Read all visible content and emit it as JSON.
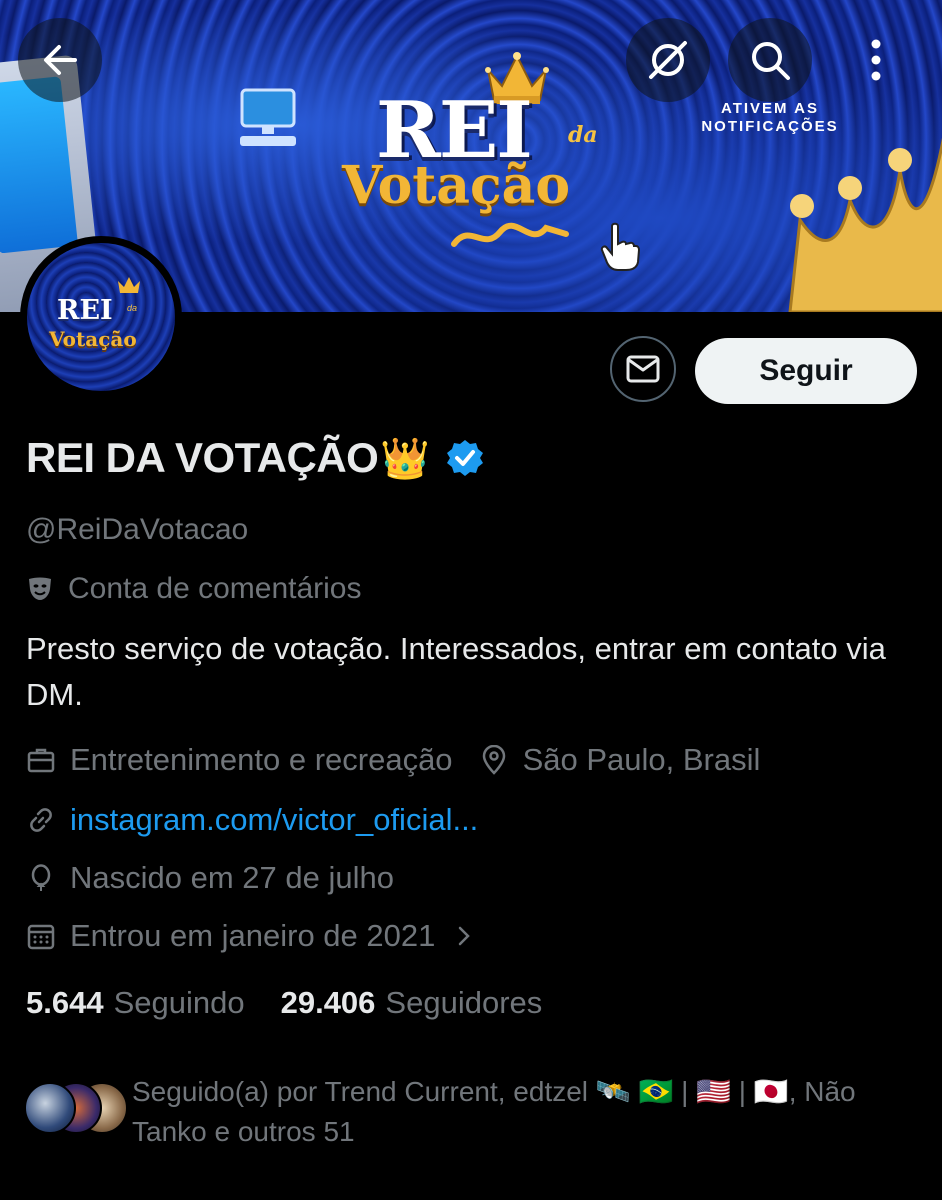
{
  "banner": {
    "title_rei": "REI",
    "title_da": "da",
    "title_votacao": "Votação",
    "notification_line1": "ATIVEM AS",
    "notification_line2": "NOTIFICAÇÕES"
  },
  "avatar": {
    "rei": "REI",
    "da": "da",
    "votacao": "Votação"
  },
  "actions": {
    "follow_label": "Seguir",
    "message_icon": "mail-icon"
  },
  "profile": {
    "name": "REI DA VOTAÇÃO",
    "name_emoji": "👑",
    "verified": true,
    "handle": "@ReiDaVotacao",
    "label": "Conta de comentários",
    "bio": "Presto serviço de votação. Interessados, entrar em contato via DM.",
    "category": "Entretenimento e recreação",
    "location": "São Paulo, Brasil",
    "website": "instagram.com/victor_oficial...",
    "birthday": "Nascido em 27 de julho",
    "joined": "Entrou em janeiro de 2021"
  },
  "stats": {
    "following_count": "5.644",
    "following_label": "Seguindo",
    "followers_count": "29.406",
    "followers_label": "Seguidores"
  },
  "followed_by": {
    "text": "Seguido(a) por Trend Current, edtzel 🛰️ 🇧🇷 | 🇺🇸 | 🇯🇵, Não Tanko e outros 51"
  },
  "colors": {
    "background": "#000000",
    "primary_text": "#e7e9ea",
    "secondary_text": "#71767b",
    "link": "#1d9bf0",
    "verified": "#1d9bf0",
    "follow_button_bg": "#eff3f4"
  }
}
